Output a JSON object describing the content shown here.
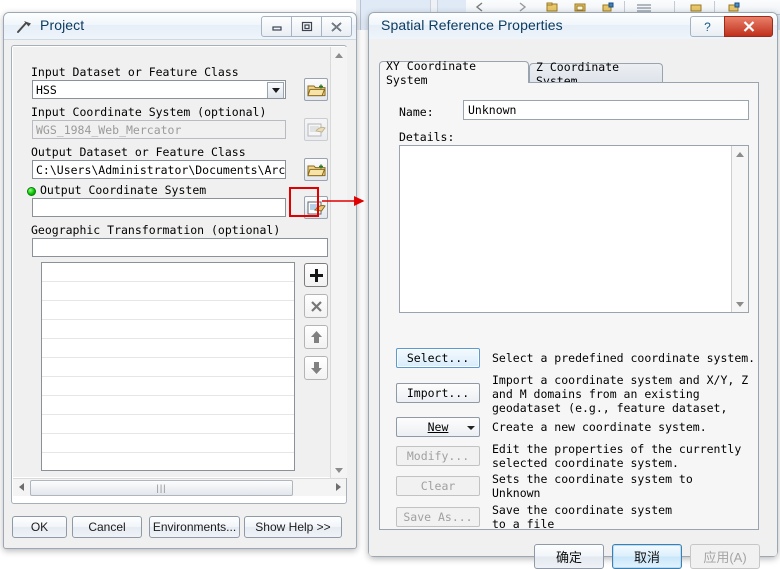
{
  "background": {
    "app": "ArcMap",
    "toolbar_icons": [
      "back-arrow-icon",
      "forward-arrow-icon",
      "open-folder-icon",
      "folder-data-icon",
      "layer-add-icon",
      "table-icon",
      "catalog-icon",
      "toolbox-icon"
    ]
  },
  "project_dialog": {
    "title": "Project",
    "icon": "hammer-tool-icon",
    "window_buttons": [
      {
        "name": "minimize-button",
        "glyph": "–"
      },
      {
        "name": "restore-button",
        "glyph": "❐"
      },
      {
        "name": "close-button",
        "glyph": "✖"
      }
    ],
    "fields": [
      {
        "label": "Input Dataset or Feature Class",
        "value": "HSS",
        "placeholder": "",
        "type": "combobox",
        "browse": "open-folder-icon",
        "disabled": false
      },
      {
        "label": "Input Coordinate System  (optional)",
        "value": "WGS_1984_Web_Mercator",
        "placeholder": "",
        "type": "text",
        "browse": "coordinate-system-icon",
        "disabled": true
      },
      {
        "label": "Output Dataset or Feature Class",
        "value": "C:\\Users\\Administrator\\Documents\\ArcGIS\\D",
        "placeholder": "",
        "type": "text",
        "browse": "open-folder-icon",
        "disabled": false
      },
      {
        "label": "Output Coordinate System",
        "value": "",
        "placeholder": "",
        "type": "text",
        "browse": "coordinate-system-icon",
        "required": true,
        "disabled": false
      },
      {
        "label": "Geographic Transformation  (optional)",
        "value": "",
        "placeholder": "",
        "type": "text",
        "disabled": false
      }
    ],
    "list": {
      "name": "geographic-transformation-list",
      "rows": [
        "",
        "",
        "",
        "",
        "",
        "",
        "",
        "",
        "",
        "",
        ""
      ],
      "side_buttons": [
        {
          "name": "add-button",
          "glyph": "➕"
        },
        {
          "name": "remove-button",
          "glyph": "✕"
        },
        {
          "name": "move-up-button",
          "glyph": "↑"
        },
        {
          "name": "move-down-button",
          "glyph": "↓"
        }
      ]
    },
    "footer_buttons": [
      {
        "name": "ok-button",
        "label": "OK"
      },
      {
        "name": "cancel-button",
        "label": "Cancel"
      },
      {
        "name": "environments-button",
        "label": "Environments..."
      },
      {
        "name": "show-help-button",
        "label": "Show Help >>"
      }
    ]
  },
  "spatial_reference_dialog": {
    "title": "Spatial Reference Properties",
    "window_buttons": [
      {
        "name": "help-button",
        "glyph": "?"
      },
      {
        "name": "close-button",
        "glyph": "✖"
      }
    ],
    "tabs": [
      {
        "label": "XY Coordinate System",
        "active": true
      },
      {
        "label": "Z Coordinate System",
        "active": false
      }
    ],
    "name_label": "Name:",
    "name_value": "Unknown",
    "details_label": "Details:",
    "details_value": "",
    "actions": [
      {
        "label": "Select...",
        "mnemonic": "",
        "state": "focused",
        "description": "Select a predefined coordinate system."
      },
      {
        "label": "Import...",
        "mnemonic": "",
        "state": "enabled",
        "description": "Import a coordinate system and X/Y, Z\nand M domains from an existing\ngeodataset (e.g., feature dataset,"
      },
      {
        "label": "New",
        "mnemonic": "N",
        "state": "dropdown",
        "description": "Create a new coordinate system."
      },
      {
        "label": "Modify...",
        "mnemonic": "",
        "state": "disabled",
        "description": "Edit the properties of the currently\nselected coordinate system."
      },
      {
        "label": "Clear",
        "mnemonic": "",
        "state": "disabled",
        "description": "Sets the coordinate system to\nUnknown"
      },
      {
        "label": "Save As...",
        "mnemonic": "",
        "state": "disabled",
        "description": "Save the coordinate system\nto a file"
      }
    ],
    "footer_buttons": [
      {
        "name": "ok-button",
        "label": "确定",
        "state": "enabled"
      },
      {
        "name": "cancel-button",
        "label": "取消",
        "state": "default"
      },
      {
        "name": "apply-button",
        "label": "应用(A)",
        "state": "disabled"
      }
    ]
  },
  "annotations": {
    "color": "#e00000",
    "items": [
      {
        "name": "highlight-output-coordinate-system-button",
        "type": "box"
      },
      {
        "name": "arrow-to-spatial-reference-dialog",
        "type": "arrow"
      },
      {
        "name": "arrow-to-select-button",
        "type": "arrow"
      },
      {
        "name": "highlight-select-button",
        "type": "box"
      }
    ]
  }
}
